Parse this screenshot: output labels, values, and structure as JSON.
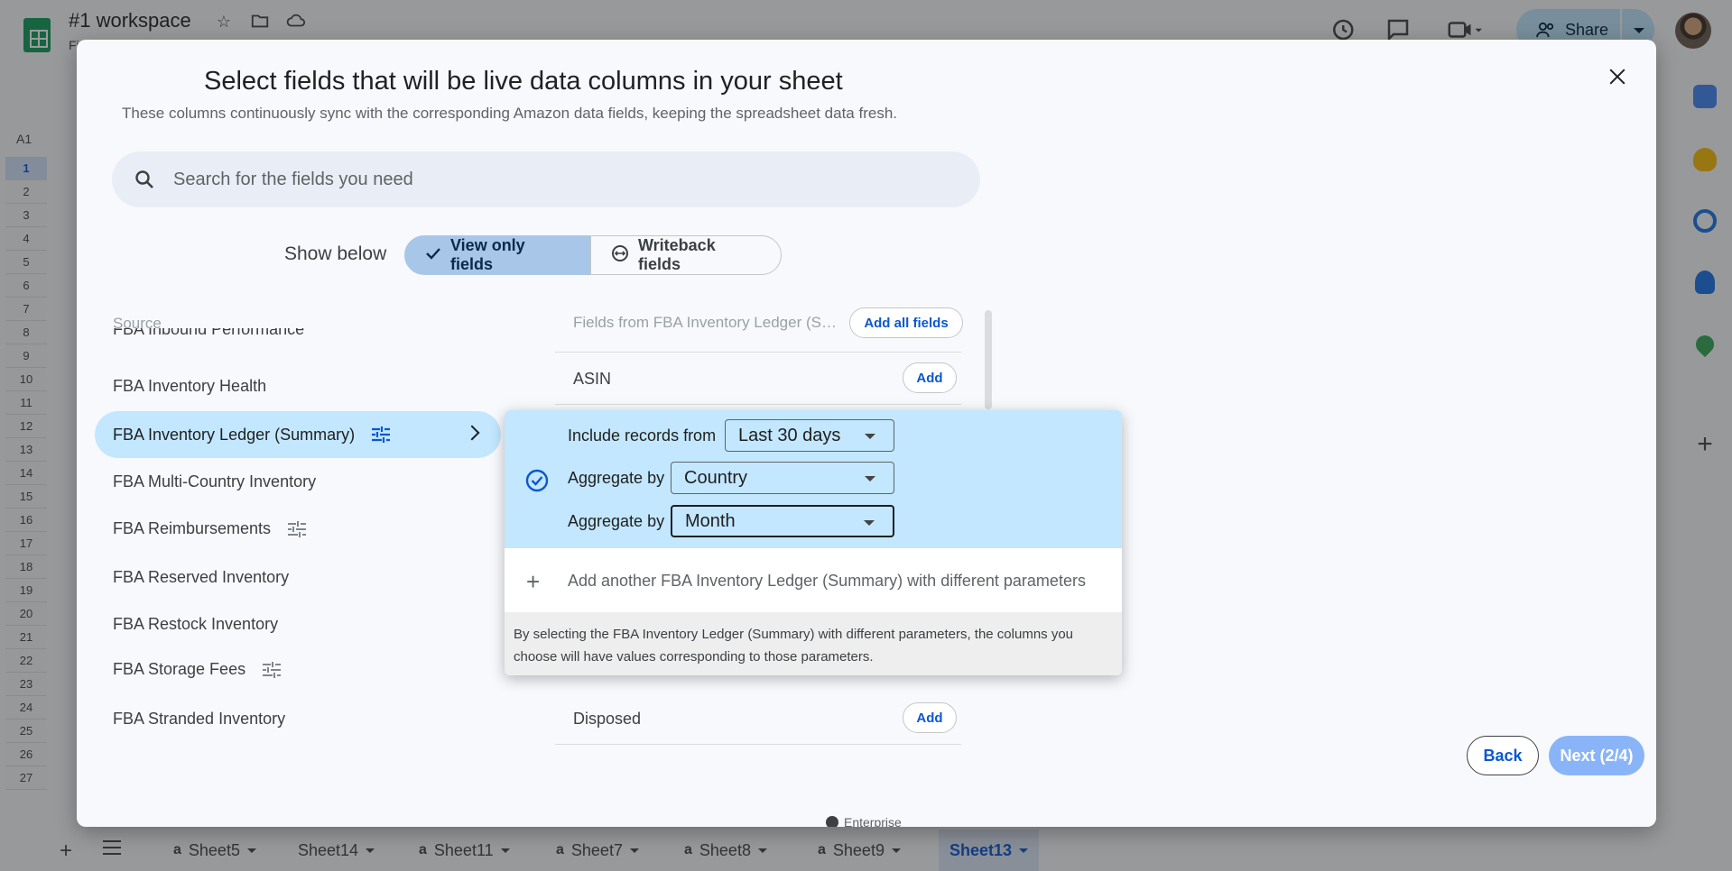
{
  "app": {
    "doc_title": "#1 workspace",
    "doc_sub": "Fi",
    "share_label": "Share",
    "name_box": "A1",
    "row_numbers": [
      "1",
      "2",
      "3",
      "4",
      "5",
      "6",
      "7",
      "8",
      "9",
      "10",
      "11",
      "12",
      "13",
      "14",
      "15",
      "16",
      "17",
      "18",
      "19",
      "20",
      "21",
      "22",
      "23",
      "24",
      "25",
      "26",
      "27"
    ],
    "sheet_tabs": [
      {
        "label": "Sheet5",
        "amazon": true
      },
      {
        "label": "Sheet14",
        "amazon": false
      },
      {
        "label": "Sheet11",
        "amazon": true
      },
      {
        "label": "Sheet7",
        "amazon": true
      },
      {
        "label": "Sheet8",
        "amazon": true
      },
      {
        "label": "Sheet9",
        "amazon": true
      },
      {
        "label": "Sheet13",
        "amazon": false,
        "active": true
      }
    ],
    "amazon_glyph": "a"
  },
  "modal": {
    "title": "Select fields that will be live data columns in your sheet",
    "subtitle": "These columns continuously sync with the corresponding Amazon data fields, keeping the spreadsheet data fresh.",
    "search": {
      "placeholder": "Search for the fields you need",
      "value": ""
    },
    "show_below": {
      "label": "Show below",
      "options": [
        {
          "label": "View only fields",
          "selected": true
        },
        {
          "label": "Writeback fields",
          "selected": false
        }
      ]
    },
    "source": {
      "header": "Source",
      "cut_item": "FBA Inbound Performance",
      "items": [
        {
          "label": "FBA Inventory Health",
          "tunable": false
        },
        {
          "label": "FBA Inventory Ledger (Summary)",
          "tunable": true,
          "selected": true
        },
        {
          "label": "FBA Multi-Country Inventory",
          "tunable": false
        },
        {
          "label": "FBA Reimbursements",
          "tunable": true
        },
        {
          "label": "FBA Reserved Inventory",
          "tunable": false
        },
        {
          "label": "FBA Restock Inventory",
          "tunable": false
        },
        {
          "label": "FBA Storage Fees",
          "tunable": true
        },
        {
          "label": "FBA Stranded Inventory",
          "tunable": false
        }
      ]
    },
    "fields": {
      "header": "Fields from FBA Inventory Ledger (Summary)",
      "add_all_label": "Add all fields",
      "rows": [
        {
          "label": "ASIN",
          "add_label": "Add"
        },
        {
          "label": "Disposed",
          "add_label": "Add"
        }
      ]
    },
    "popover": {
      "include_label": "Include records from",
      "include_value": "Last 30 days",
      "agg1_label": "Aggregate by",
      "agg1_value": "Country",
      "agg2_label": "Aggregate by",
      "agg2_value": "Month",
      "add_another": "Add another FBA Inventory Ledger (Summary) with different parameters",
      "note": "By selecting the FBA Inventory Ledger (Summary) with different parameters, the columns you choose will have values corresponding to those parameters."
    },
    "back_label": "Back",
    "next_label": "Next (2/4)",
    "footer": "Enterprise"
  },
  "colors": {
    "accent": "#0b57d0",
    "selected_bg": "#c2e7ff",
    "segment_selected": "#a8c7e8",
    "next_disabled": "#8ab4f8"
  }
}
